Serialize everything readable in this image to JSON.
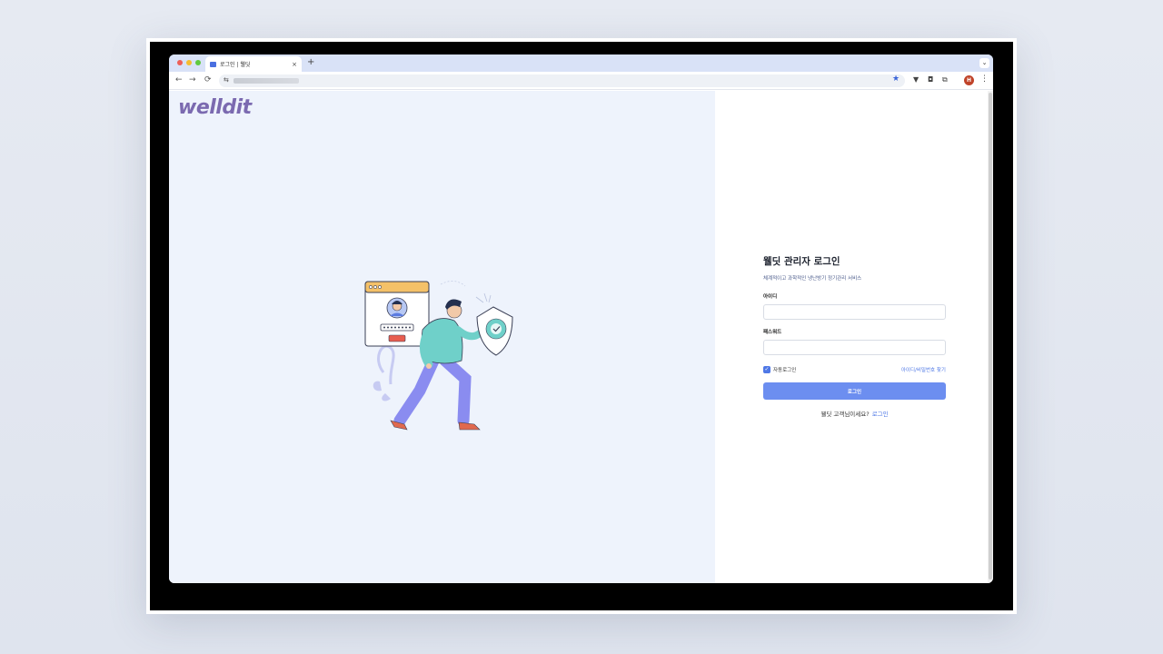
{
  "browser": {
    "tab_title": "로그인 | 웰딧",
    "tab_close": "×",
    "new_tab": "+",
    "tab_menu": "⌄",
    "back": "←",
    "forward": "→",
    "reload": "⟳",
    "site_info": "⇆",
    "bookmark_star": "★",
    "profile_initial": "H",
    "menu": "⋮"
  },
  "logo": "welldit",
  "login": {
    "title": "웰딧 관리자 로그인",
    "subtitle": "체계적이고 과학적인 냉난방기 정기관리 서비스",
    "id_label": "아이디",
    "id_value": "",
    "password_label": "패스워드",
    "password_value": "",
    "auto_login_label": "자동로그인",
    "auto_login_checked": true,
    "find_link": "아이디/비밀번호 찾기",
    "submit_label": "로그인",
    "customer_question": "웰딧 고객님이세요?",
    "customer_login_link": "로그인"
  },
  "colors": {
    "accent": "#6c8ef0",
    "link": "#4f78e6",
    "logo": "#7b6ab0",
    "left_bg": "#eef3fc"
  }
}
